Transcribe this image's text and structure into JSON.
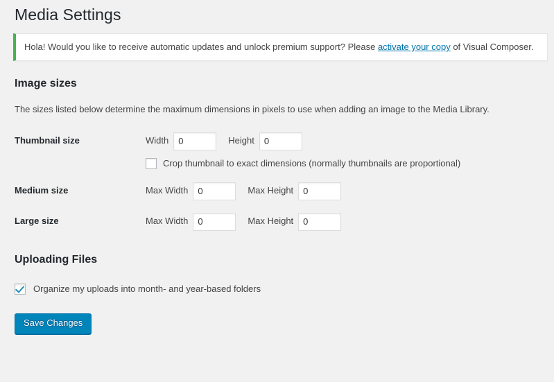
{
  "page": {
    "title": "Media Settings"
  },
  "notice": {
    "icon": "green-left-bar",
    "text_before": "Hola! Would you like to receive automatic updates and unlock premium support? Please ",
    "link_text": "activate your copy",
    "text_after": " of Visual Composer.",
    "accent_color": "#46b450",
    "link_color": "#0073aa"
  },
  "image_sizes": {
    "heading": "Image sizes",
    "description": "The sizes listed below determine the maximum dimensions in pixels to use when adding an image to the Media Library.",
    "rows": [
      {
        "label": "Thumbnail size",
        "fields": [
          {
            "label": "Width",
            "value": "0"
          },
          {
            "label": "Height",
            "value": "0"
          }
        ],
        "checkbox": {
          "label": "Crop thumbnail to exact dimensions (normally thumbnails are proportional)",
          "checked": false
        }
      },
      {
        "label": "Medium size",
        "fields": [
          {
            "label": "Max Width",
            "value": "0"
          },
          {
            "label": "Max Height",
            "value": "0"
          }
        ]
      },
      {
        "label": "Large size",
        "fields": [
          {
            "label": "Max Width",
            "value": "0"
          },
          {
            "label": "Max Height",
            "value": "0"
          }
        ]
      }
    ]
  },
  "uploading_files": {
    "heading": "Uploading Files",
    "checkbox": {
      "label": "Organize my uploads into month- and year-based folders",
      "checked": true
    }
  },
  "submit": {
    "label": "Save Changes",
    "color": "#0085ba"
  }
}
